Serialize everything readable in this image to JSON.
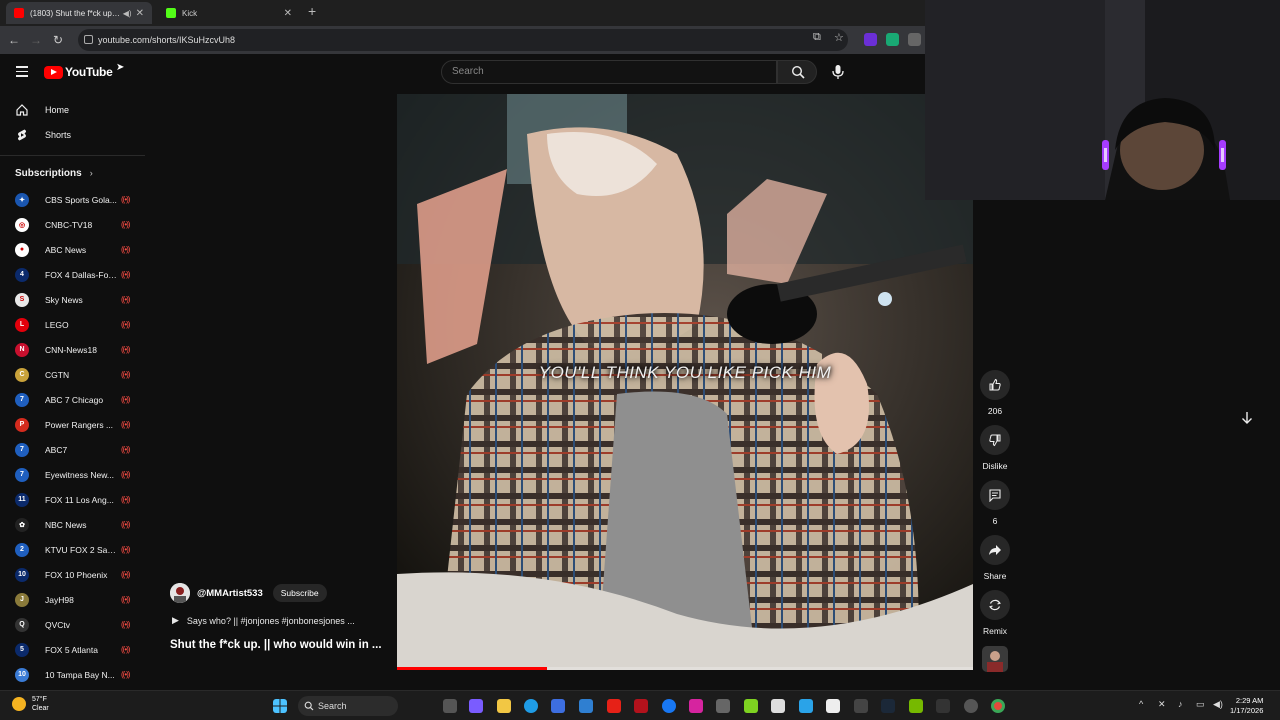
{
  "browser": {
    "tabs": [
      {
        "title": "(1803) Shut the f*ck up. || w",
        "favicon_color": "#ff0000"
      },
      {
        "title": "Kick",
        "favicon_color": "#53fc18"
      }
    ],
    "address": "youtube.com/shorts/IKSuHzcvUh8"
  },
  "header": {
    "logo_text": "YouTube",
    "search_placeholder": "Search"
  },
  "sidebar": {
    "nav": [
      {
        "label": "Home",
        "icon": "home-icon"
      },
      {
        "label": "Shorts",
        "icon": "shorts-icon"
      }
    ],
    "subscriptions_title": "Subscriptions",
    "subscriptions": [
      {
        "name": "CBS Sports Gola...",
        "color": "#1a56b0",
        "glyph": "✦"
      },
      {
        "name": "CNBC-TV18",
        "color": "#ffffff",
        "glyph": "◎"
      },
      {
        "name": "ABC News",
        "color": "#ffffff",
        "glyph": "●"
      },
      {
        "name": "FOX 4 Dallas-For...",
        "color": "#0b2a6b",
        "glyph": "4"
      },
      {
        "name": "Sky News",
        "color": "#e8e8e8",
        "glyph": "S"
      },
      {
        "name": "LEGO",
        "color": "#e3000b",
        "glyph": "L"
      },
      {
        "name": "CNN-News18",
        "color": "#c8102e",
        "glyph": "N"
      },
      {
        "name": "CGTN",
        "color": "#c9a23a",
        "glyph": "C"
      },
      {
        "name": "ABC 7 Chicago",
        "color": "#1f5fbf",
        "glyph": "7"
      },
      {
        "name": "Power Rangers ...",
        "color": "#d42b1e",
        "glyph": "P"
      },
      {
        "name": "ABC7",
        "color": "#1f5fbf",
        "glyph": "7"
      },
      {
        "name": "Eyewitness New...",
        "color": "#1f5fbf",
        "glyph": "7"
      },
      {
        "name": "FOX 11 Los Ang...",
        "color": "#0b2a6b",
        "glyph": "11"
      },
      {
        "name": "NBC News",
        "color": "#222222",
        "glyph": "✿"
      },
      {
        "name": "KTVU FOX 2 San...",
        "color": "#1f5fbf",
        "glyph": "2"
      },
      {
        "name": "FOX 10 Phoenix",
        "color": "#0b2a6b",
        "glyph": "10"
      },
      {
        "name": "JayH98",
        "color": "#8a7a3a",
        "glyph": "J"
      },
      {
        "name": "QVCtv",
        "color": "#333333",
        "glyph": "Q"
      },
      {
        "name": "FOX 5 Atlanta",
        "color": "#0b2a6b",
        "glyph": "5"
      },
      {
        "name": "10 Tampa Bay N...",
        "color": "#3a7bd5",
        "glyph": "10"
      }
    ]
  },
  "video": {
    "caption": "YOU'LL THINK YOU LIKE PICK HIM",
    "progress": 0.26
  },
  "channel": {
    "handle": "@MMArtist533",
    "subscribe_label": "Subscribe",
    "description": "Says who? || #jonjones #jonbonesjones ...",
    "title": "Shut the f*ck up. || who would win in ..."
  },
  "actions": [
    {
      "icon": "like-icon",
      "label": "206"
    },
    {
      "icon": "dislike-icon",
      "label": "Dislike"
    },
    {
      "icon": "comment-icon",
      "label": "6"
    },
    {
      "icon": "share-icon",
      "label": "Share"
    },
    {
      "icon": "remix-icon",
      "label": "Remix"
    }
  ],
  "taskbar": {
    "temperature": "57°F",
    "condition": "Clear",
    "search_label": "Search",
    "time": "2:29 AM",
    "date": "1/17/2026"
  }
}
